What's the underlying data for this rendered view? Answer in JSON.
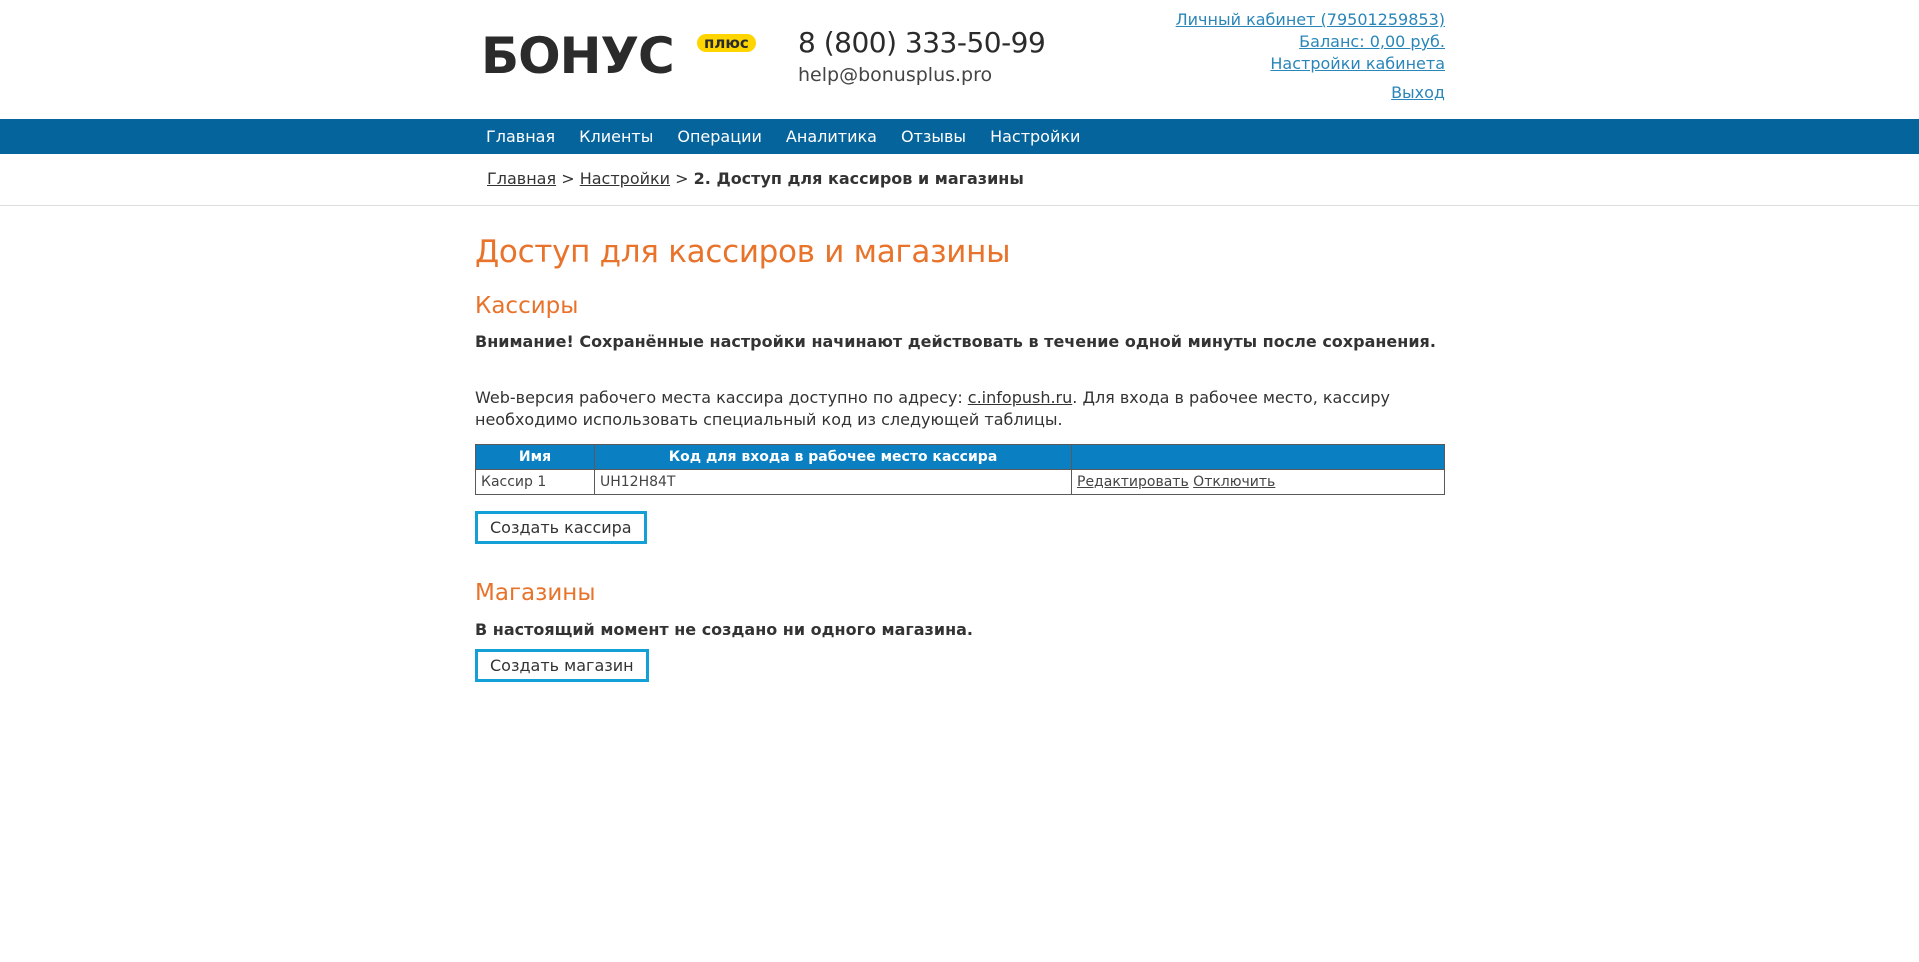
{
  "header": {
    "logo_text": "БОНУС",
    "logo_badge": "плюс",
    "phone": "8 (800) 333-50-99",
    "email": "help@bonusplus.pro",
    "account_link": "Личный кабинет (79501259853)",
    "balance_link": "Баланс: 0,00 руб.",
    "settings_link": "Настройки кабинета",
    "logout_link": "Выход"
  },
  "nav": {
    "items": [
      "Главная",
      "Клиенты",
      "Операции",
      "Аналитика",
      "Отзывы",
      "Настройки"
    ]
  },
  "breadcrumb": {
    "home": "Главная",
    "settings": "Настройки",
    "separator": ">",
    "current": "2. Доступ для кассиров и магазины"
  },
  "page": {
    "title": "Доступ для кассиров и магазины"
  },
  "cashiers": {
    "heading": "Кассиры",
    "notice": "Внимание! Сохранённые настройки начинают действовать в течение одной минуты после сохранения.",
    "info_before": "Web-версия рабочего места кассира доступно по адресу: ",
    "info_link": "c.infopush.ru",
    "info_after": ". Для входа в рабочее место, кассиру необходимо использовать специальный код из следующей таблицы.",
    "table": {
      "columns": [
        "Имя",
        "Код для входа в рабочее место кассира",
        ""
      ],
      "rows": [
        {
          "name": "Кассир 1",
          "code": "UH12H84T",
          "edit": "Редактировать",
          "disable": "Отключить"
        }
      ]
    },
    "create_button": "Создать кассира"
  },
  "shops": {
    "heading": "Магазины",
    "empty_text": "В настоящий момент не создано ни одного магазина.",
    "create_button": "Создать магазин"
  }
}
